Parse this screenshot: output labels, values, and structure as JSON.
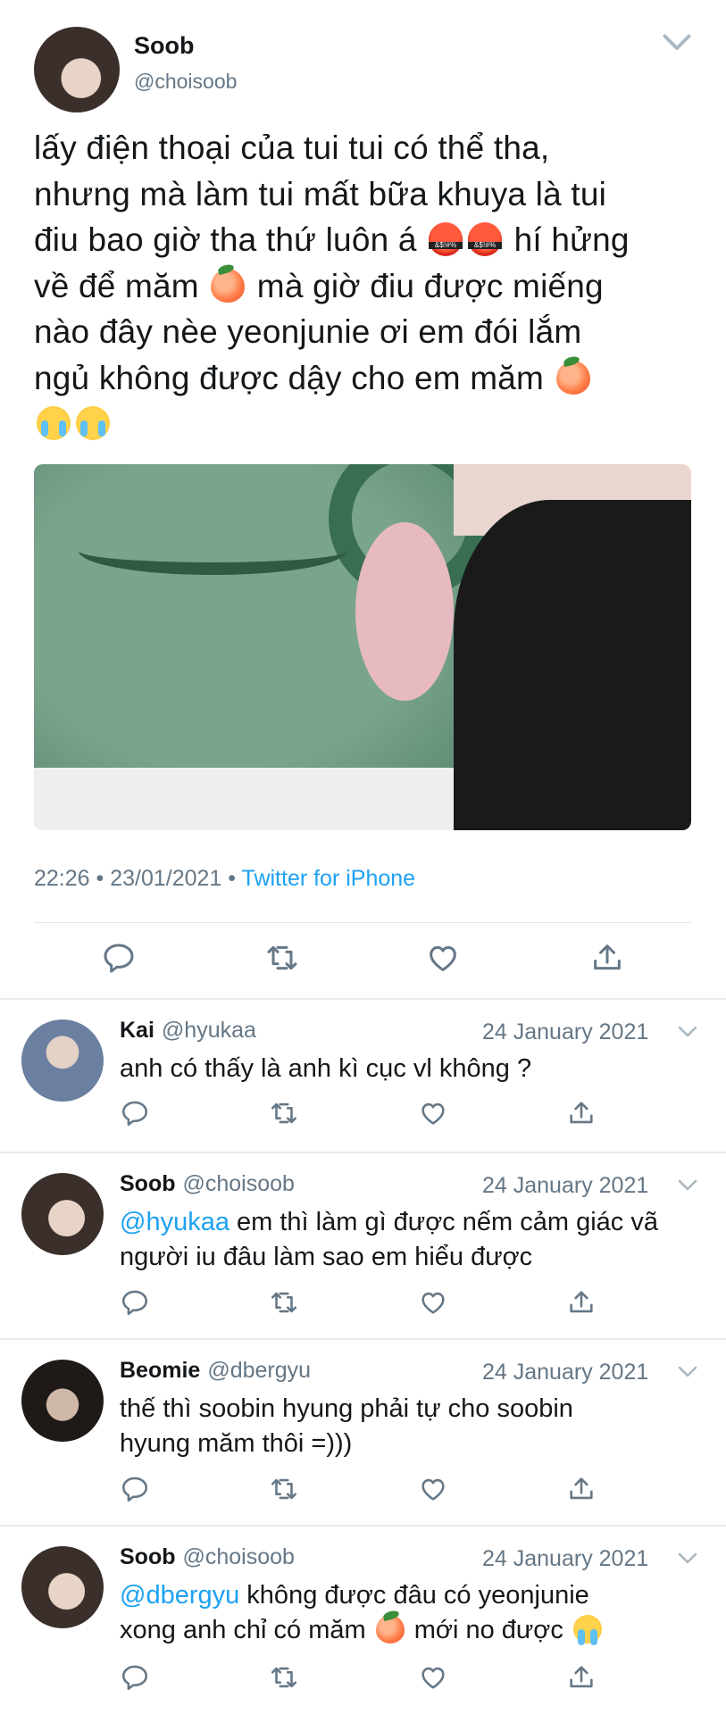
{
  "main_tweet": {
    "name": "Soob",
    "handle": "@choisoob",
    "lines": [
      {
        "parts": [
          "lấy điện thoại của tui tui có thể tha,"
        ]
      },
      {
        "parts": [
          "nhưng mà làm tui mất bữa khuya là tui"
        ]
      },
      {
        "parts": [
          "điu bao giờ tha thứ luôn á",
          " hí hửng"
        ]
      },
      {
        "parts": [
          "về để măm",
          " mà giờ điu được miếng"
        ]
      },
      {
        "parts": [
          "nào đây nèe yeonjunie ơi em đói lắm"
        ]
      },
      {
        "parts": [
          "ngủ không được dậy cho em măm"
        ]
      }
    ],
    "time": "22:26",
    "date": "23/01/2021",
    "source": "Twitter for iPhone",
    "emoji": [
      "angry-face-with-symbols",
      "peach",
      "loudly-crying-face"
    ]
  },
  "replies": [
    {
      "name": "Kai",
      "handle": "@hyukaa",
      "date": "24 January 2021",
      "mention": "",
      "text": "anh có thấy là anh kì cục vl không ?",
      "text2": ""
    },
    {
      "name": "Soob",
      "handle": "@choisoob",
      "date": "24 January 2021",
      "mention": "@hyukaa",
      "text": " em thì làm gì được nếm cảm giác vã",
      "text2": "người iu đâu làm sao em hiểu được"
    },
    {
      "name": "Beomie",
      "handle": "@dbergyu",
      "date": "24 January 2021",
      "mention": "",
      "text": "thế thì soobin hyung phải tự cho soobin",
      "text2": "hyung măm thôi =)))"
    },
    {
      "name": "Soob",
      "handle": "@choisoob",
      "date": "24 January 2021",
      "mention": "@dbergyu",
      "text": " không được đâu có yeonjunie",
      "text2": "xong anh chỉ có măm",
      "text3": " mới no được"
    }
  ],
  "icons": [
    "reply-icon",
    "retweet-icon",
    "like-icon",
    "share-icon",
    "chevron-down-icon"
  ],
  "colors": {
    "link": "#1da1f2",
    "muted": "#657786",
    "divider": "#e1e8ed"
  }
}
